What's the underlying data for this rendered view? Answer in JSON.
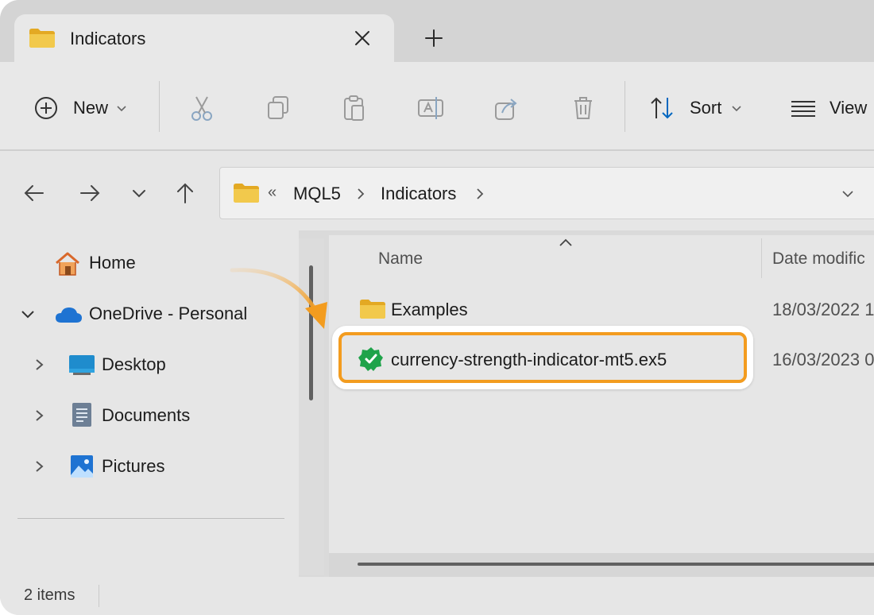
{
  "window": {
    "tab_title": "Indicators",
    "close_icon": "close-icon",
    "new_tab_icon": "plus-icon"
  },
  "toolbar": {
    "new_label": "New",
    "sort_label": "Sort",
    "view_label": "View",
    "icons": [
      "plus-circle-icon",
      "cut-icon",
      "copy-icon",
      "paste-icon",
      "rename-icon",
      "share-icon",
      "delete-icon",
      "sort-icon",
      "view-icon"
    ]
  },
  "address": {
    "overflow": "«",
    "crumbs": [
      "MQL5",
      "Indicators"
    ]
  },
  "nav": {
    "items": [
      {
        "label": "Home",
        "icon": "home-icon"
      },
      {
        "label": "OneDrive - Personal",
        "icon": "cloud-icon"
      },
      {
        "label": "Desktop",
        "icon": "desktop-icon"
      },
      {
        "label": "Documents",
        "icon": "documents-icon"
      },
      {
        "label": "Pictures",
        "icon": "pictures-icon"
      }
    ]
  },
  "files": {
    "columns": [
      "Name",
      "Date modific"
    ],
    "rows": [
      {
        "name": "Examples",
        "date": "18/03/2022 1",
        "icon": "folder-icon"
      },
      {
        "name": "currency-strength-indicator-mt5.ex5",
        "date": "16/03/2023 0",
        "icon": "verified-badge-icon"
      }
    ]
  },
  "status": {
    "count": "2 items"
  },
  "colors": {
    "highlight": "#f39c1f",
    "folder": "#e8b93a",
    "accent": "#0067c0",
    "badge": "#1fa34a"
  }
}
